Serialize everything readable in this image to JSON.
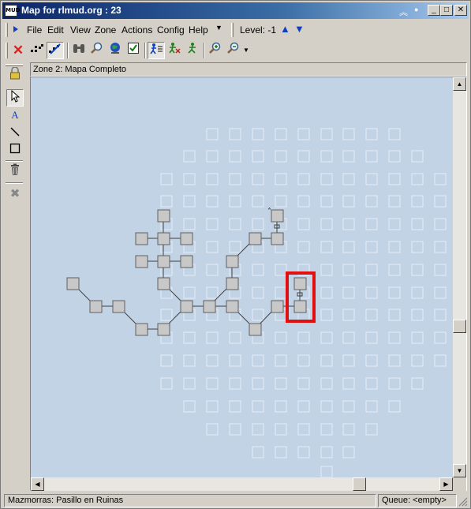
{
  "window": {
    "title": "Map for rlmud.org : 23",
    "app_icon_text": "MUD"
  },
  "menubar": {
    "items": [
      "File",
      "Edit",
      "View",
      "Zone",
      "Actions",
      "Config",
      "Help"
    ],
    "level_label": "Level: -1"
  },
  "toolbar": {
    "icons": [
      "delete-icon",
      "map-rooms-icon",
      "auto-map-icon",
      "binoculars-icon",
      "find-icon",
      "globe-icon",
      "check-icon",
      "walk-mode-icon",
      "speedwalk-icon",
      "runner-icon",
      "zoom-in-icon",
      "zoom-out-icon"
    ]
  },
  "palette": {
    "icons": [
      "lock-icon",
      "pointer-tool-icon",
      "text-tool-icon",
      "line-tool-icon",
      "rect-tool-icon",
      "trash-icon",
      "cancel-icon"
    ],
    "text_tool_glyph": "A"
  },
  "map": {
    "zone_title": "Zone 2: Mapa Completo",
    "colors": {
      "background": "#c2d3e6",
      "room_fill": "#c8c8c8",
      "room_border": "#606060",
      "ghost_room": "#e6eef7",
      "selection": "#e01010"
    },
    "up_marker": "˄"
  },
  "status": {
    "location": "Mazmorras: Pasillo en Ruinas",
    "queue": "Queue: <empty>"
  }
}
